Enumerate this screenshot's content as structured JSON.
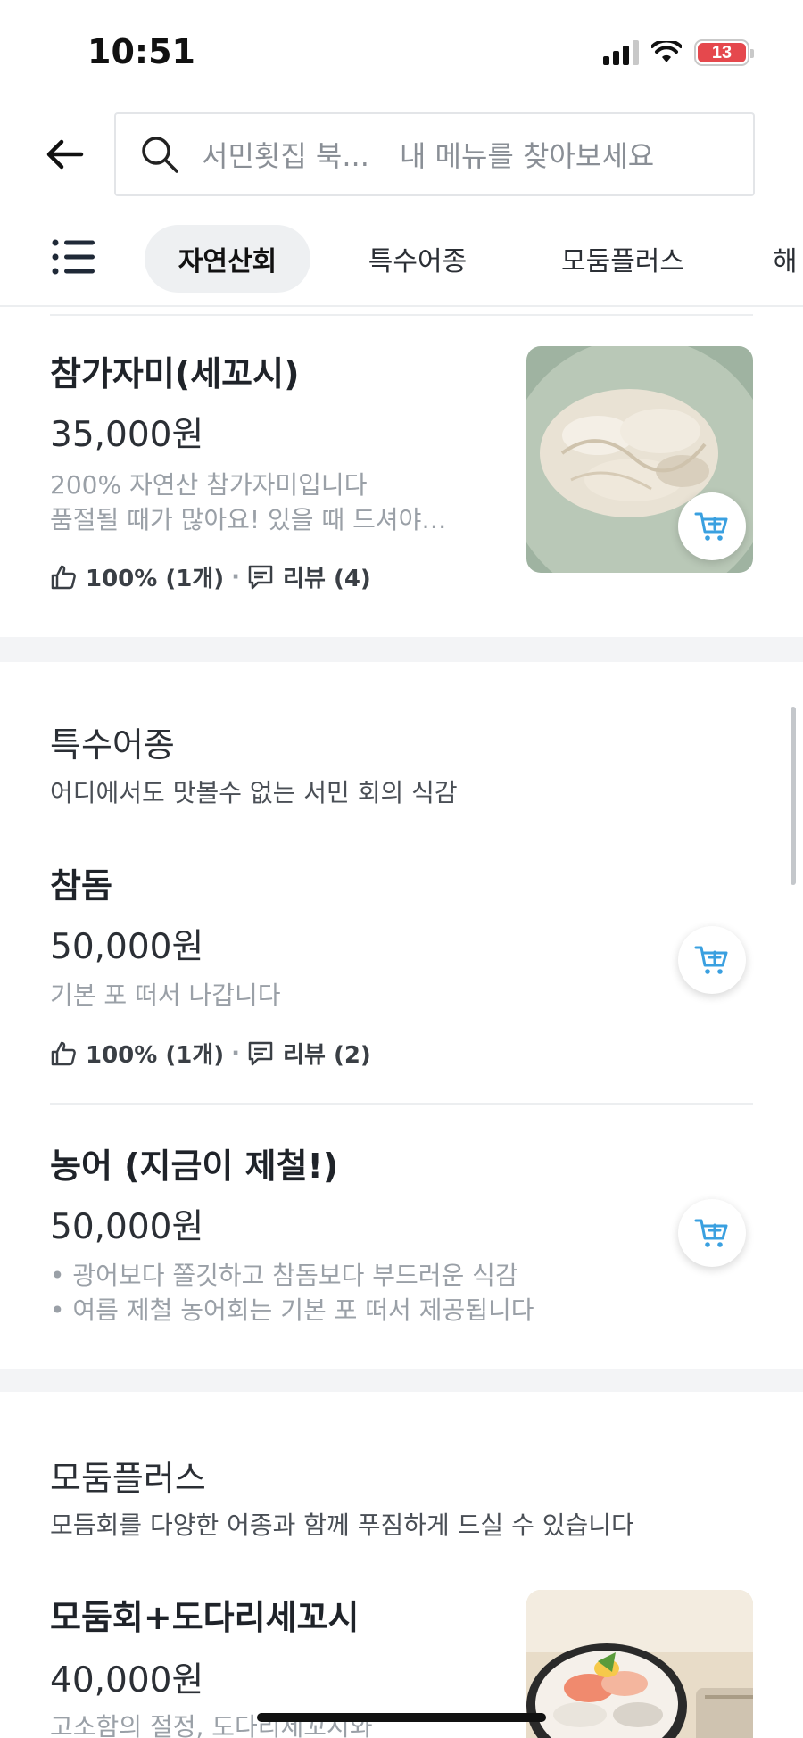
{
  "status_bar": {
    "time": "10:51",
    "battery": "13"
  },
  "search": {
    "prefix": "서민횟집 북...",
    "placeholder": "내 메뉴를 찾아보세요"
  },
  "tabs": [
    {
      "label": "자연산회",
      "active": true
    },
    {
      "label": "특수어종",
      "active": false
    },
    {
      "label": "모둠플러스",
      "active": false
    },
    {
      "label": "해",
      "active": false
    }
  ],
  "items_top": [
    {
      "name": "참가자미(세꼬시)",
      "price": "35,000원",
      "desc_lines": [
        "200% 자연산 참가자미입니다",
        "품절될 때가 많아요! 있을 때 드셔야…"
      ],
      "likes": "100% (1개)",
      "reviews": "리뷰 (4)"
    }
  ],
  "sections": [
    {
      "title": "특수어종",
      "description": "어디에서도 맛볼수 없는 서민 회의 식감",
      "items": [
        {
          "name": "참돔",
          "price": "50,000원",
          "desc_lines": [
            "기본 포 떠서 나갑니다"
          ],
          "likes": "100% (1개)",
          "reviews": "리뷰 (2)"
        },
        {
          "name": "농어 (지금이 제철!)",
          "price": "50,000원",
          "desc_lines": [
            "• 광어보다 쫄깃하고 참돔보다 부드러운 식감",
            "• 여름 제철 농어회는 기본 포 떠서 제공됩니다"
          ]
        }
      ]
    },
    {
      "title": "모둠플러스",
      "description": "모듬회를 다양한 어종과 함께 푸짐하게 드실 수 있습니다",
      "items": [
        {
          "name": "모둠회+도다리세꼬시",
          "price": "40,000원",
          "desc_lines": [
            "고소함의 절정, 도다리세꼬시와"
          ]
        }
      ]
    }
  ],
  "colors": {
    "accent": "#3aa0e0",
    "band": "#f3f4f6",
    "battery": "#e5484d"
  },
  "icons": {
    "back": "arrow-left-icon",
    "search": "search-icon",
    "menu": "list-menu-icon",
    "like": "thumbs-up-icon",
    "review": "chat-bubble-icon",
    "cart": "cart-plus-icon"
  }
}
